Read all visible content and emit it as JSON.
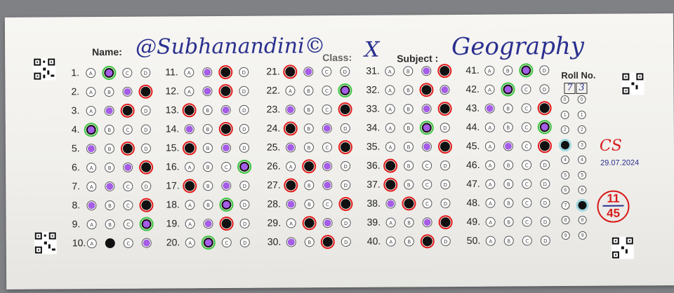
{
  "header": {
    "name_label": "Name:",
    "name_value": "@Subhanandini©",
    "class_label": "Class:",
    "class_value": "X",
    "subject_label": "Subject :",
    "subject_value": "Geography",
    "roll_label": "Roll No.",
    "roll_digits": [
      "7",
      "3"
    ]
  },
  "options": [
    "A",
    "B",
    "C",
    "D"
  ],
  "questions": [
    {
      "n": "1.",
      "filled": 1,
      "correct": 1,
      "mark": "green"
    },
    {
      "n": "2.",
      "filled": 3,
      "correct": 2,
      "mark": "red"
    },
    {
      "n": "3.",
      "filled": 2,
      "correct": 1,
      "mark": "red"
    },
    {
      "n": "4.",
      "filled": 0,
      "correct": 0,
      "mark": "green"
    },
    {
      "n": "5.",
      "filled": 2,
      "correct": 0,
      "mark": "red"
    },
    {
      "n": "6.",
      "filled": 3,
      "correct": 2,
      "mark": "red"
    },
    {
      "n": "7.",
      "filled": -1,
      "correct": 1,
      "mark": "none"
    },
    {
      "n": "8.",
      "filled": 3,
      "correct": 0,
      "mark": "red"
    },
    {
      "n": "9.",
      "filled": 3,
      "correct": 3,
      "mark": "green"
    },
    {
      "n": "10.",
      "filled": 1,
      "correct": 3,
      "mark": "none"
    },
    {
      "n": "11.",
      "filled": 2,
      "correct": 1,
      "mark": "red"
    },
    {
      "n": "12.",
      "filled": 2,
      "correct": 1,
      "mark": "red"
    },
    {
      "n": "13.",
      "filled": 0,
      "correct": 2,
      "mark": "red"
    },
    {
      "n": "14.",
      "filled": 2,
      "correct": 0,
      "mark": "red"
    },
    {
      "n": "15.",
      "filled": 0,
      "correct": 2,
      "mark": "red"
    },
    {
      "n": "16.",
      "filled": 3,
      "correct": 3,
      "mark": "green"
    },
    {
      "n": "17.",
      "filled": 0,
      "correct": 2,
      "mark": "red"
    },
    {
      "n": "18.",
      "filled": 2,
      "correct": 2,
      "mark": "green"
    },
    {
      "n": "19.",
      "filled": 2,
      "correct": 1,
      "mark": "red"
    },
    {
      "n": "20.",
      "filled": 1,
      "correct": 1,
      "mark": "green"
    },
    {
      "n": "21.",
      "filled": 0,
      "correct": 1,
      "mark": "red"
    },
    {
      "n": "22.",
      "filled": 3,
      "correct": 3,
      "mark": "green"
    },
    {
      "n": "23.",
      "filled": 3,
      "correct": 0,
      "mark": "red"
    },
    {
      "n": "24.",
      "filled": 0,
      "correct": 2,
      "mark": "red"
    },
    {
      "n": "25.",
      "filled": 3,
      "correct": 0,
      "mark": "red"
    },
    {
      "n": "26.",
      "filled": 1,
      "correct": 2,
      "mark": "red"
    },
    {
      "n": "27.",
      "filled": 0,
      "correct": 2,
      "mark": "red"
    },
    {
      "n": "28.",
      "filled": 3,
      "correct": 0,
      "mark": "red"
    },
    {
      "n": "29.",
      "filled": 1,
      "correct": 2,
      "mark": "red"
    },
    {
      "n": "30.",
      "filled": 2,
      "correct": 0,
      "mark": "red"
    },
    {
      "n": "31.",
      "filled": 3,
      "correct": 2,
      "mark": "red"
    },
    {
      "n": "32.",
      "filled": 2,
      "correct": 3,
      "mark": "red"
    },
    {
      "n": "33.",
      "filled": 3,
      "correct": 2,
      "mark": "red"
    },
    {
      "n": "34.",
      "filled": 2,
      "correct": 2,
      "mark": "green"
    },
    {
      "n": "35.",
      "filled": 3,
      "correct": 2,
      "mark": "red"
    },
    {
      "n": "36.",
      "filled": 0,
      "correct": -1,
      "mark": "red"
    },
    {
      "n": "37.",
      "filled": 0,
      "correct": -1,
      "mark": "red"
    },
    {
      "n": "38.",
      "filled": 1,
      "correct": 0,
      "mark": "red"
    },
    {
      "n": "39.",
      "filled": 3,
      "correct": 2,
      "mark": "red"
    },
    {
      "n": "40.",
      "filled": 2,
      "correct": -1,
      "mark": "red"
    },
    {
      "n": "41.",
      "filled": 2,
      "correct": 2,
      "mark": "green"
    },
    {
      "n": "42.",
      "filled": 1,
      "correct": 1,
      "mark": "green"
    },
    {
      "n": "43.",
      "filled": 3,
      "correct": 0,
      "mark": "red"
    },
    {
      "n": "44.",
      "filled": 3,
      "correct": 3,
      "mark": "green"
    },
    {
      "n": "45.",
      "filled": 3,
      "correct": 1,
      "mark": "red"
    },
    {
      "n": "46.",
      "filled": -1,
      "correct": -1,
      "mark": "none"
    },
    {
      "n": "47.",
      "filled": -1,
      "correct": -1,
      "mark": "none"
    },
    {
      "n": "48.",
      "filled": -1,
      "correct": -1,
      "mark": "none"
    },
    {
      "n": "49.",
      "filled": -1,
      "correct": -1,
      "mark": "none"
    },
    {
      "n": "50.",
      "filled": -1,
      "correct": -1,
      "mark": "none"
    }
  ],
  "roll_bubbles": [
    "0",
    "1",
    "2",
    "3",
    "4",
    "5",
    "6",
    "7",
    "8",
    "9"
  ],
  "roll_selected": [
    "3",
    "7"
  ],
  "grading": {
    "signature": "CS",
    "date": "29.07.2024",
    "score_obtained": "11",
    "score_total": "45"
  },
  "colors": {
    "wrong_mark": "#e31919",
    "right_mark": "#37c43a",
    "key_dot": "#a55ce6",
    "ink": "#2a2f8f"
  }
}
